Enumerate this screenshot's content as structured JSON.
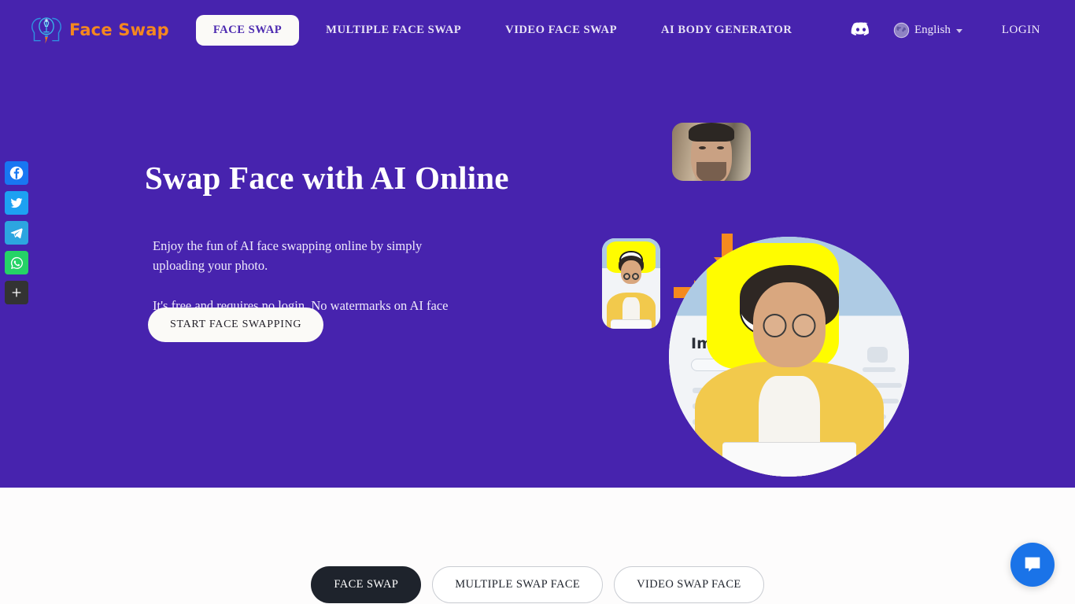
{
  "header": {
    "logo": {
      "text": "Face Swap",
      "icon": "faceswap-head-bulb-icon",
      "color": "#f5871f"
    },
    "nav": [
      {
        "label": "FACE SWAP",
        "active": true
      },
      {
        "label": "MULTIPLE FACE SWAP",
        "active": false
      },
      {
        "label": "VIDEO FACE SWAP",
        "active": false
      },
      {
        "label": "AI BODY GENERATOR",
        "active": false
      }
    ],
    "discord_icon": "discord-icon",
    "language": {
      "icon": "globe-icon",
      "label": "English",
      "caret": "chevron-down-icon"
    },
    "login_label": "LOGIN"
  },
  "social": {
    "items": [
      {
        "name": "facebook",
        "icon": "facebook-icon",
        "color": "#1877f2"
      },
      {
        "name": "twitter",
        "icon": "twitter-icon",
        "color": "#1da1f2"
      },
      {
        "name": "telegram",
        "icon": "telegram-icon",
        "color": "#2ca5e0"
      },
      {
        "name": "whatsapp",
        "icon": "whatsapp-icon",
        "color": "#25d366"
      },
      {
        "name": "more",
        "icon": "plus-icon",
        "color": "#333333"
      }
    ]
  },
  "hero": {
    "title": "Swap Face with AI Online",
    "paragraph1": "Enjoy the fun of AI face swapping online by simply uploading your photo.",
    "paragraph2": "It's free and requires no login. No watermarks on AI face swap image.",
    "cta_label": "START FACE SWAPPING",
    "background_color": "#4723ae",
    "collage": {
      "source_face_label": "source-face-thumbnail",
      "target_photo_label": "target-photo-thumbnail",
      "result_label": "swapped-result-image",
      "result_username": "Imran",
      "arrow_color": "#f58a1f"
    }
  },
  "lower": {
    "tabs": [
      {
        "label": "FACE SWAP",
        "active": true
      },
      {
        "label": "MULTIPLE SWAP FACE",
        "active": false
      },
      {
        "label": "VIDEO SWAP FACE",
        "active": false
      }
    ],
    "background_color": "#fdfcfc"
  },
  "chat": {
    "icon": "chat-bubble-icon",
    "color": "#1a73e8"
  }
}
